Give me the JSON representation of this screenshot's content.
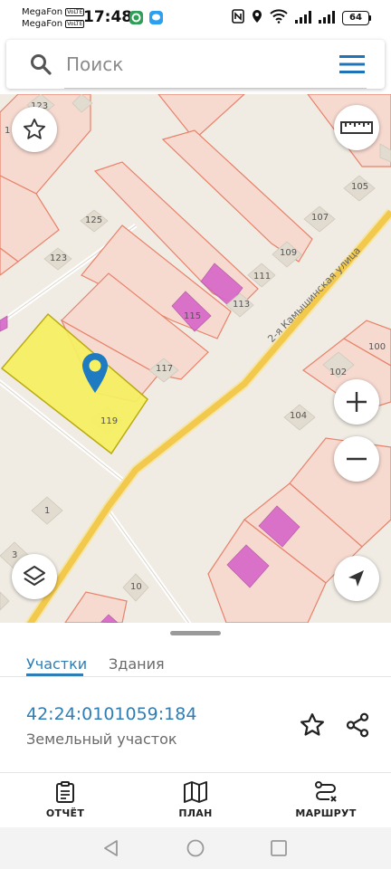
{
  "status_bar": {
    "carrier_1": "MegaFon",
    "carrier_2": "MegaFon",
    "volte_badge": "VoLTE",
    "time": "17:48",
    "battery": "64",
    "icons": [
      "app-icon-green",
      "chat-app-icon",
      "nfc-icon",
      "location-icon",
      "wifi-icon",
      "signal-icon",
      "signal-icon-2",
      "battery-icon"
    ]
  },
  "search": {
    "placeholder": "Поиск"
  },
  "map": {
    "street_name": "2-я Камышинская улица",
    "house_numbers": [
      "123",
      "1",
      "125",
      "123",
      "105",
      "107",
      "109",
      "111",
      "113",
      "115",
      "117",
      "119",
      "100",
      "102",
      "104",
      "1",
      "3",
      "10"
    ],
    "colors": {
      "background": "#f0ece4",
      "parcel_fill": "#f6d9cf",
      "parcel_stroke": "#e8826a",
      "selected_parcel": "#f7f060",
      "building": "#d766c9",
      "road": "#f2c94c",
      "pin": "#1f7bc1"
    }
  },
  "bottom_sheet": {
    "tabs": [
      {
        "label": "Участки",
        "active": true
      },
      {
        "label": "Здания",
        "active": false
      }
    ],
    "cadastral_number": "42:24:0101059:184",
    "parcel_type": "Земельный участок",
    "actions": [
      {
        "label": "ОТЧЁТ",
        "icon": "clipboard-icon"
      },
      {
        "label": "ПЛАН",
        "icon": "map-icon"
      },
      {
        "label": "МАРШРУТ",
        "icon": "route-icon"
      }
    ],
    "accent_color": "#2f7db5"
  }
}
